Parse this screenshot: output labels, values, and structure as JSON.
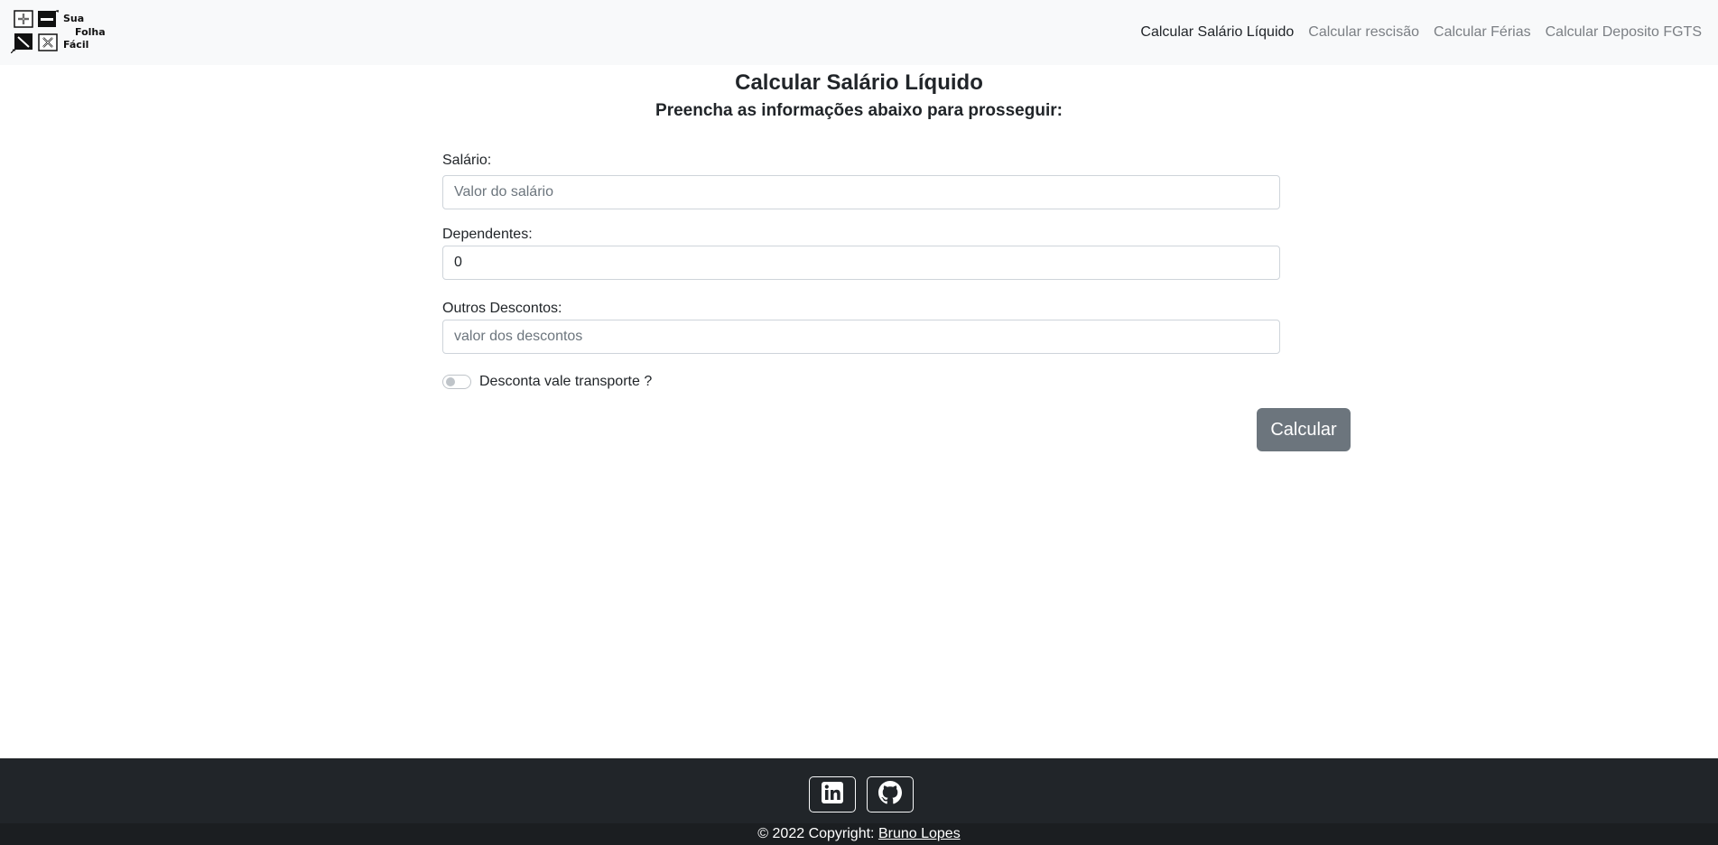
{
  "brand": {
    "line1": "Sua",
    "line2": "Folha",
    "line3": "Fácil",
    "icons": [
      "plus-icon",
      "minus-icon",
      "divide-icon",
      "multiply-icon"
    ]
  },
  "nav": {
    "items": [
      {
        "label": "Calcular Salário Líquido",
        "active": true
      },
      {
        "label": "Calcular rescisão",
        "active": false
      },
      {
        "label": "Calcular Férias",
        "active": false
      },
      {
        "label": "Calcular Deposito FGTS",
        "active": false
      }
    ]
  },
  "main": {
    "title": "Calcular Salário Líquido",
    "subtitle": "Preencha as informações abaixo para prosseguir:"
  },
  "form": {
    "salario_label": "Salário:",
    "salario_placeholder": "Valor do salário",
    "dependentes_label": "Dependentes:",
    "dependentes_value": "0",
    "descontos_label": "Outros Descontos:",
    "descontos_placeholder": "valor dos descontos",
    "vt_label": "Desconta vale transporte ?",
    "vt_checked": false,
    "submit_label": "Calcular"
  },
  "footer": {
    "social": [
      "linkedin-icon",
      "github-icon"
    ],
    "copyright_prefix": "© 2022 Copyright: ",
    "author": "Bruno Lopes"
  },
  "colors": {
    "navbar_bg": "#f8f9fa",
    "button_bg": "#6c757d",
    "footer_bg": "#212529",
    "footer_bottom_bg": "#1b1e21"
  }
}
